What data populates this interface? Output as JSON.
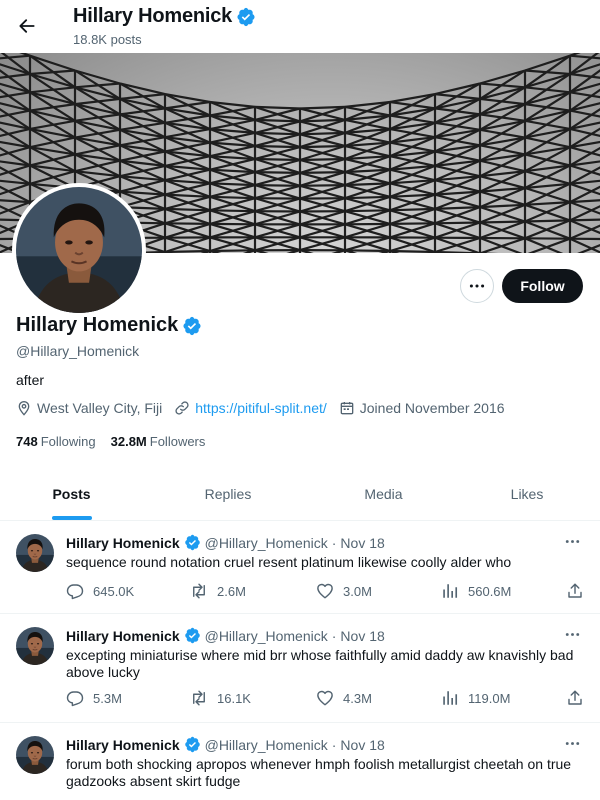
{
  "header": {
    "name": "Hillary Homenick",
    "posts_count": "18.8K posts"
  },
  "profile": {
    "name": "Hillary Homenick",
    "handle": "@Hillary_Homenick",
    "bio": "after",
    "location": "West Valley City, Fiji",
    "website": "https://pitiful-split.net/",
    "joined": "Joined November 2016",
    "following_count": "748",
    "following_label": "Following",
    "followers_count": "32.8M",
    "followers_label": "Followers",
    "follow_label": "Follow"
  },
  "tabs": [
    {
      "label": "Posts",
      "active": true
    },
    {
      "label": "Replies",
      "active": false
    },
    {
      "label": "Media",
      "active": false
    },
    {
      "label": "Likes",
      "active": false
    }
  ],
  "posts": [
    {
      "name": "Hillary Homenick",
      "handle": "@Hillary_Homenick",
      "dot": "·",
      "date": "Nov 18",
      "text": "sequence round notation cruel resent platinum likewise coolly alder who",
      "replies": "645.0K",
      "reposts": "2.6M",
      "likes": "3.0M",
      "views": "560.6M"
    },
    {
      "name": "Hillary Homenick",
      "handle": "@Hillary_Homenick",
      "dot": "·",
      "date": "Nov 18",
      "text": "excepting miniaturise where mid brr whose faithfully amid daddy aw knavishly bad above lucky",
      "replies": "5.3M",
      "reposts": "16.1K",
      "likes": "4.3M",
      "views": "119.0M"
    },
    {
      "name": "Hillary Homenick",
      "handle": "@Hillary_Homenick",
      "dot": "·",
      "date": "Nov 18",
      "text": "forum both shocking apropos whenever hmph foolish metallurgist cheetah on true gadzooks absent skirt fudge"
    }
  ],
  "icons": {
    "back": "arrow-left-icon",
    "verified": "verified-badge-icon",
    "location": "location-pin-icon",
    "link": "link-icon",
    "calendar": "calendar-icon",
    "more": "more-horizontal-icon",
    "reply": "reply-icon",
    "repost": "repost-icon",
    "like": "heart-icon",
    "views": "views-icon",
    "share": "share-icon"
  },
  "colors": {
    "accent": "#1d9bf0",
    "text_primary": "#0f1419",
    "text_secondary": "#536471",
    "follow_button": "#0f1419",
    "divider": "#eff3f4"
  }
}
